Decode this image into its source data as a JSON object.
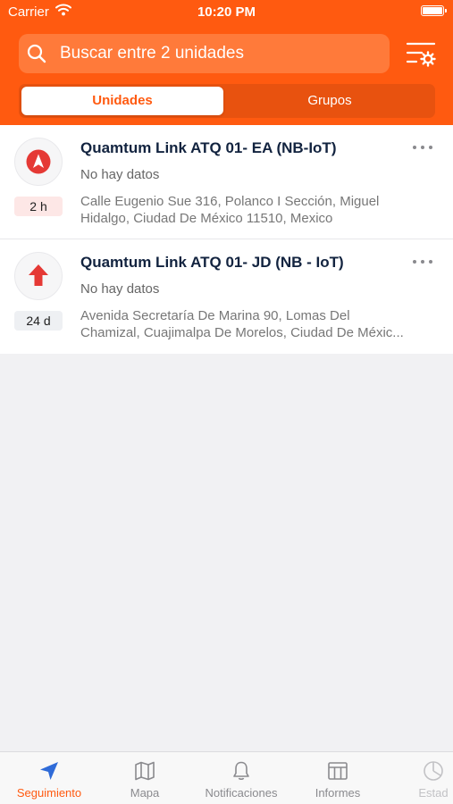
{
  "status_bar": {
    "carrier": "Carrier",
    "time": "10:20 PM"
  },
  "search": {
    "placeholder": "Buscar entre 2 unidades"
  },
  "segments": {
    "active": "Unidades",
    "inactive": "Grupos"
  },
  "units": [
    {
      "name": "Quamtum Link ATQ 01- EA (NB-IoT)",
      "status": "No hay datos",
      "time": "2 h",
      "address_line1": "Calle Eugenio Sue 316, Polanco I Sección, Miguel",
      "address_line2": "Hidalgo, Ciudad De México 11510, Mexico"
    },
    {
      "name": "Quamtum Link ATQ 01- JD (NB - IoT)",
      "status": "No hay datos",
      "time": "24 d",
      "address_line1": "Avenida Secretaría De Marina 90, Lomas Del",
      "address_line2": "Chamizal, Cuajimalpa De Morelos, Ciudad De Méxic..."
    }
  ],
  "tabs": [
    {
      "label": "Seguimiento",
      "icon": "navigation-arrow-icon",
      "active": true
    },
    {
      "label": "Mapa",
      "icon": "map-icon",
      "active": false
    },
    {
      "label": "Notificaciones",
      "icon": "bell-icon",
      "active": false
    },
    {
      "label": "Informes",
      "icon": "reports-table-icon",
      "active": false
    },
    {
      "label": "Estad",
      "icon": "pie-chart-icon",
      "active": false
    }
  ],
  "colors": {
    "accent": "#ff5a10",
    "title_text": "#12233f",
    "alert_red": "#e53935",
    "badge_red_bg": "#fde7e6",
    "badge_gray_bg": "#eef0f3"
  }
}
